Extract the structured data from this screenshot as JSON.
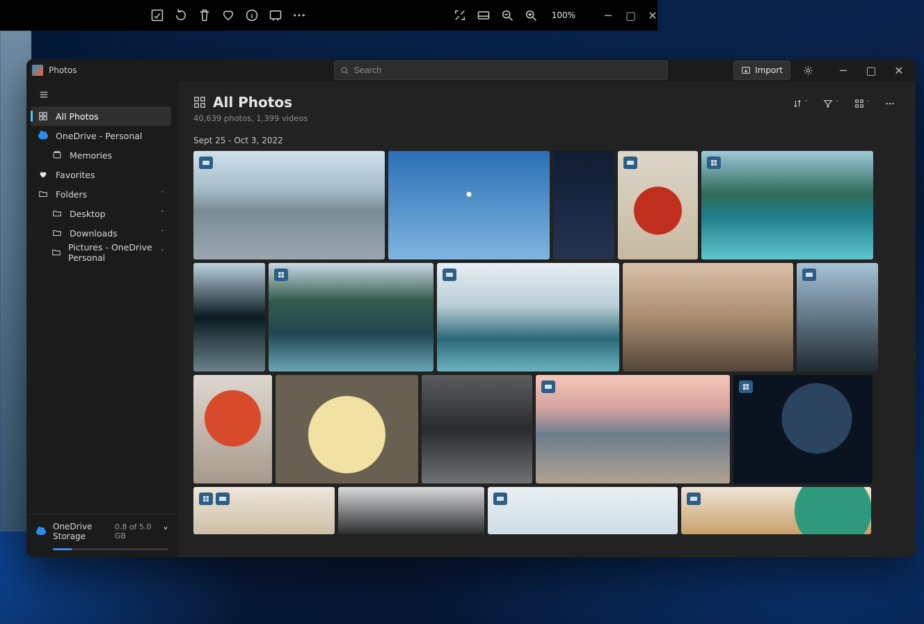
{
  "viewer": {
    "zoom_label": "100%"
  },
  "app": {
    "title": "Photos"
  },
  "search": {
    "placeholder": "Search"
  },
  "topbar": {
    "import_label": "Import"
  },
  "sidebar": {
    "all_photos": "All Photos",
    "onedrive": "OneDrive - Personal",
    "memories": "Memories",
    "favorites": "Favorites",
    "folders": "Folders",
    "desktop": "Desktop",
    "downloads": "Downloads",
    "pictures_od": "Pictures - OneDrive Personal"
  },
  "storage": {
    "label": "OneDrive Storage",
    "value": "0.8 of 5.0 GB"
  },
  "main": {
    "title": "All Photos",
    "subtitle": "40,639 photos, 1,399 videos",
    "date_label": "Sept 25 - Oct 3, 2022"
  }
}
